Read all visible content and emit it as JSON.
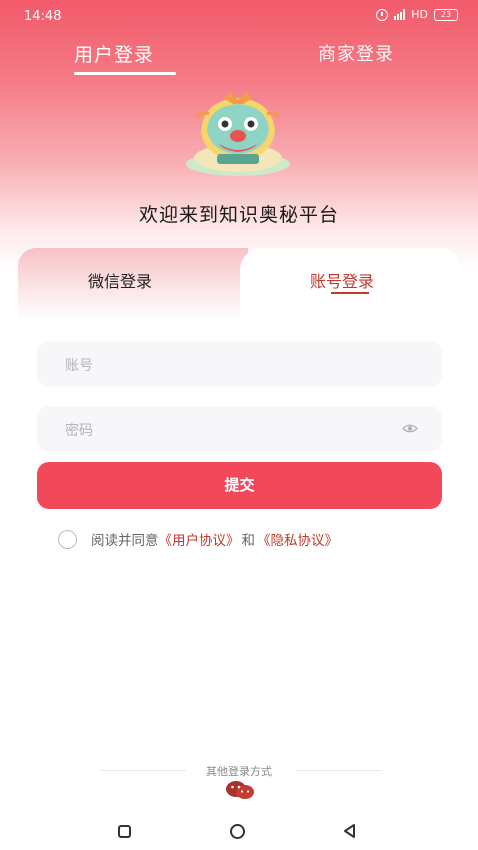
{
  "status_bar": {
    "time": "14:48",
    "network": "HD",
    "battery": "23"
  },
  "role_tabs": {
    "user": "用户登录",
    "merchant": "商家登录"
  },
  "welcome": "欢迎来到知识奥秘平台",
  "login_tabs": {
    "wechat": "微信登录",
    "account": "账号登录"
  },
  "form": {
    "account_placeholder": "账号",
    "password_placeholder": "密码",
    "submit": "提交"
  },
  "agreement": {
    "prefix": "阅读并同意",
    "user_agreement": "《用户协议》",
    "and": "和",
    "privacy_agreement": "《隐私协议》"
  },
  "other_login": "其他登录方式",
  "colors": {
    "accent": "#f1485a",
    "link": "#c0392b"
  }
}
